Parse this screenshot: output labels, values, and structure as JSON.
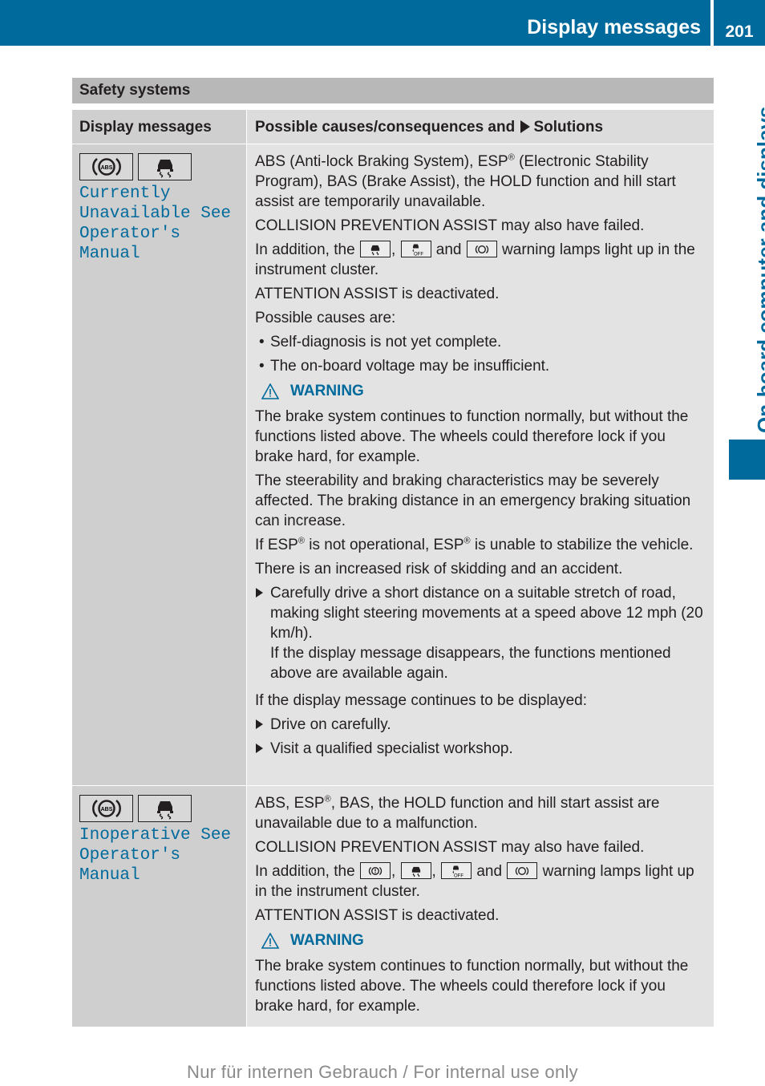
{
  "header": {
    "title": "Display messages",
    "page_number": "201",
    "side_tab": "On-board computer and displays",
    "accent_color": "#006a9c"
  },
  "section": {
    "title": "Safety systems",
    "columns": {
      "messages": "Display messages",
      "causes": "Possible causes/consequences and",
      "solutions": "Solutions"
    }
  },
  "rows": [
    {
      "icons": [
        "abs-icon",
        "esp-skid-icon"
      ],
      "message_lines": [
        "Currently",
        "Unavailable See",
        "Operator's Manual"
      ],
      "p1a": "ABS (Anti-lock Braking System), ESP",
      "p1b": " (Electronic Stability Program), BAS (Brake Assist), the HOLD function and hill start assist are temporarily unavailable.",
      "p2": "COLLISION PREVENTION ASSIST may also have failed.",
      "p3_pre": "In addition, the",
      "p3_sep1": ",",
      "p3_and": "and",
      "p3_post": "warning lamps light up in the instrument cluster.",
      "p4": "ATTENTION ASSIST is deactivated.",
      "p5": "Possible causes are:",
      "bullets": [
        "Self-diagnosis is not yet complete.",
        "The on-board voltage may be insufficient."
      ],
      "warning_label": "WARNING",
      "w1": "The brake system continues to function normally, but without the functions listed above. The wheels could therefore lock if you brake hard, for example.",
      "w2": "The steerability and braking characteristics may be severely affected. The braking distance in an emergency braking situation can increase.",
      "w3a": "If ESP",
      "w3b": " is not operational, ESP",
      "w3c": " is unable to stabilize the vehicle.",
      "w4": "There is an increased risk of skidding and an accident.",
      "step1": "Carefully drive a short distance on a suitable stretch of road, making slight steering movements at a speed above 12 mph (20 km/h).",
      "step1_note": "If the display message disappears, the functions mentioned above are available again.",
      "p6": "If the display message continues to be displayed:",
      "steps": [
        "Drive on carefully.",
        "Visit a qualified specialist workshop."
      ]
    },
    {
      "icons": [
        "abs-icon",
        "esp-skid-icon"
      ],
      "message_lines": [
        "Inoperative See",
        "Operator's Manual"
      ],
      "p1a": "ABS, ESP",
      "p1b": ", BAS, the HOLD function and hill start assist are unavailable due to a malfunction.",
      "p2": "COLLISION PREVENTION ASSIST may also have failed.",
      "p3_pre": "In addition, the",
      "p3_sep1": ",",
      "p3_sep2": ",",
      "p3_and": "and",
      "p3_post": "warning lamps light up in the instrument cluster.",
      "p4": "ATTENTION ASSIST is deactivated.",
      "warning_label": "WARNING",
      "w1": "The brake system continues to function normally, but without the functions listed above. The wheels could therefore lock if you brake hard, for example."
    }
  ],
  "registered_mark": "®",
  "footer": "Nur für internen Gebrauch / For internal use only"
}
